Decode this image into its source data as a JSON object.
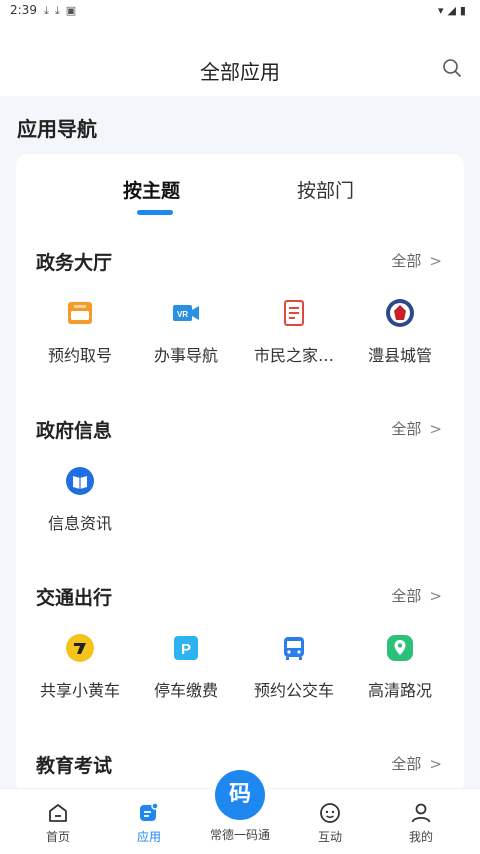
{
  "status_bar": {
    "time": "2:39"
  },
  "header": {
    "title": "全部应用"
  },
  "section_title": "应用导航",
  "tabs": [
    {
      "label": "按主题"
    },
    {
      "label": "按部门"
    }
  ],
  "groups": [
    {
      "title": "政务大厅",
      "all_label": "全部",
      "apps": [
        {
          "label": "预约取号",
          "icon": "ticket-icon"
        },
        {
          "label": "办事导航",
          "icon": "vr-camera-icon"
        },
        {
          "label": "市民之家…",
          "icon": "document-icon"
        },
        {
          "label": "澧县城管",
          "icon": "emblem-icon"
        }
      ]
    },
    {
      "title": "政府信息",
      "all_label": "全部",
      "apps": [
        {
          "label": "信息资讯",
          "icon": "news-book-icon"
        }
      ]
    },
    {
      "title": "交通出行",
      "all_label": "全部",
      "apps": [
        {
          "label": "共享小黄车",
          "icon": "bike-share-icon"
        },
        {
          "label": "停车缴费",
          "icon": "parking-icon"
        },
        {
          "label": "预约公交车",
          "icon": "bus-icon"
        },
        {
          "label": "高清路况",
          "icon": "map-pin-icon"
        }
      ]
    },
    {
      "title": "教育考试",
      "all_label": "全部",
      "apps": []
    }
  ],
  "bottom_nav": [
    {
      "label": "首页",
      "icon": "home-icon"
    },
    {
      "label": "应用",
      "icon": "apps-icon"
    },
    {
      "label": "常德一码通",
      "icon": "code-icon",
      "badge": "码"
    },
    {
      "label": "互动",
      "icon": "chat-icon"
    },
    {
      "label": "我的",
      "icon": "person-icon"
    }
  ],
  "colors": {
    "accent": "#1e87f0",
    "background": "#f3f6fa"
  }
}
